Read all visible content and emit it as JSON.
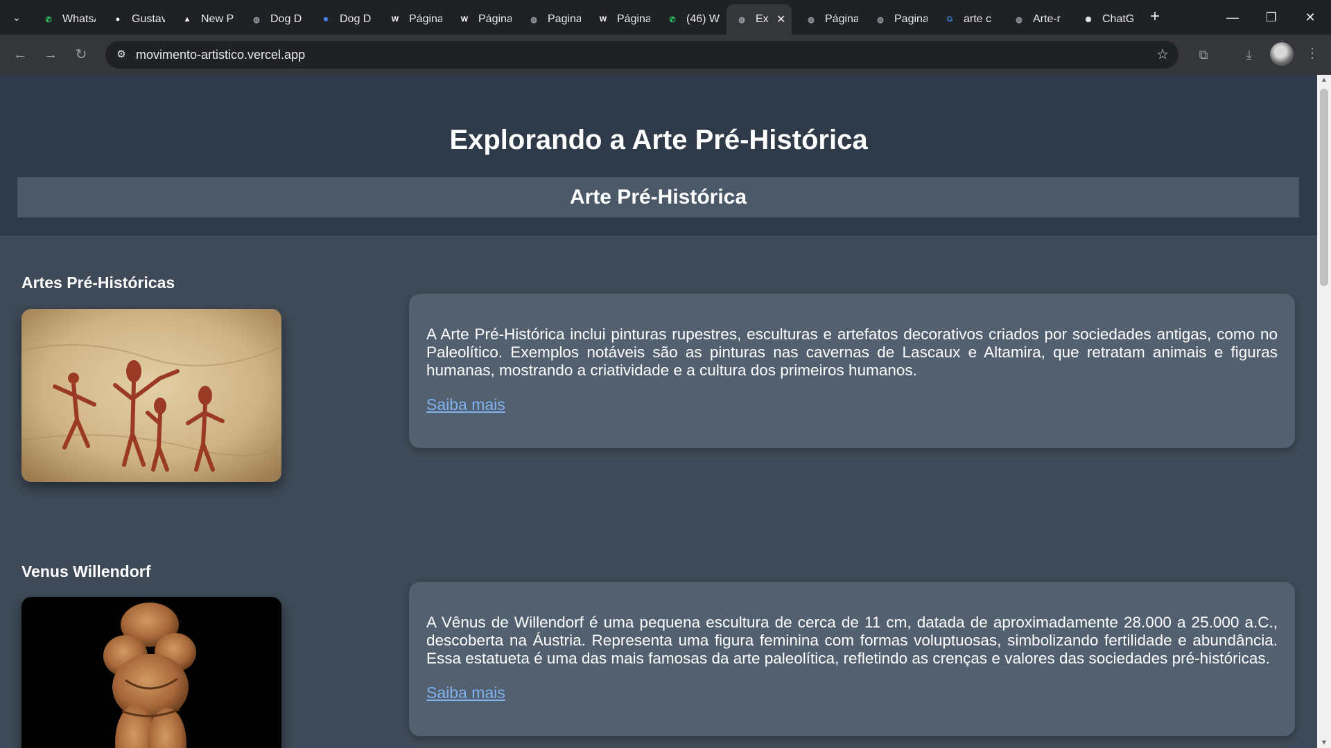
{
  "browser": {
    "tabs": [
      {
        "title": "WhatsApp",
        "icon": "whatsapp-icon",
        "color": "#25d366"
      },
      {
        "title": "Gustavo",
        "icon": "github-icon",
        "color": "#ffffff"
      },
      {
        "title": "New P",
        "icon": "vercel-icon",
        "color": "#ffffff"
      },
      {
        "title": "Dog D",
        "icon": "globe-icon",
        "color": "#9aa0a6"
      },
      {
        "title": "Dog D",
        "icon": "contact-icon",
        "color": "#4285f4"
      },
      {
        "title": "Página",
        "icon": "ws-icon",
        "color": "#ffffff"
      },
      {
        "title": "Página",
        "icon": "ws-icon",
        "color": "#ffffff"
      },
      {
        "title": "Pagina",
        "icon": "globe-icon",
        "color": "#9aa0a6"
      },
      {
        "title": "Página",
        "icon": "ws-icon",
        "color": "#ffffff"
      },
      {
        "title": "(46) W",
        "icon": "whatsapp-icon",
        "color": "#25d366"
      },
      {
        "title": "Ex",
        "icon": "globe-icon",
        "color": "#9aa0a6",
        "active": true
      },
      {
        "title": "Página",
        "icon": "globe-icon",
        "color": "#9aa0a6"
      },
      {
        "title": "Pagina",
        "icon": "globe-icon",
        "color": "#9aa0a6"
      },
      {
        "title": "arte c",
        "icon": "google-icon",
        "color": "#4285f4"
      },
      {
        "title": "Arte-r",
        "icon": "globe-icon",
        "color": "#9aa0a6"
      },
      {
        "title": "ChatG",
        "icon": "openai-icon",
        "color": "#e8eaed"
      }
    ],
    "url": "movimento-artistico.vercel.app"
  },
  "page": {
    "title": "Explorando a Arte Pré-Histórica",
    "subtitle": "Arte Pré-Histórica",
    "sections": [
      {
        "heading": "Artes Pré-Históricas",
        "text": "A Arte Pré-Histórica inclui pinturas rupestres, esculturas e artefatos decorativos criados por sociedades antigas, como no Paleolítico. Exemplos notáveis são as pinturas nas cavernas de Lascaux e Altamira, que retratam animais e figuras humanas, mostrando a criatividade e a cultura dos primeiros humanos.",
        "link": "Saiba mais"
      },
      {
        "heading": "Venus Willendorf",
        "text": "A Vênus de Willendorf é uma pequena escultura de cerca de 11 cm, datada de aproximadamente 28.000 a 25.000 a.C., descoberta na Áustria. Representa uma figura feminina com formas voluptuosas, simbolizando fertilidade e abundância. Essa estatueta é uma das mais famosas da arte paleolítica, refletindo as crenças e valores das sociedades pré-históricas.",
        "link": "Saiba mais"
      }
    ]
  },
  "colors": {
    "header_bg": "#2e3a48",
    "page_bg": "#3e4a58",
    "card_bg": "#52606f",
    "link": "#7fb2f0"
  }
}
